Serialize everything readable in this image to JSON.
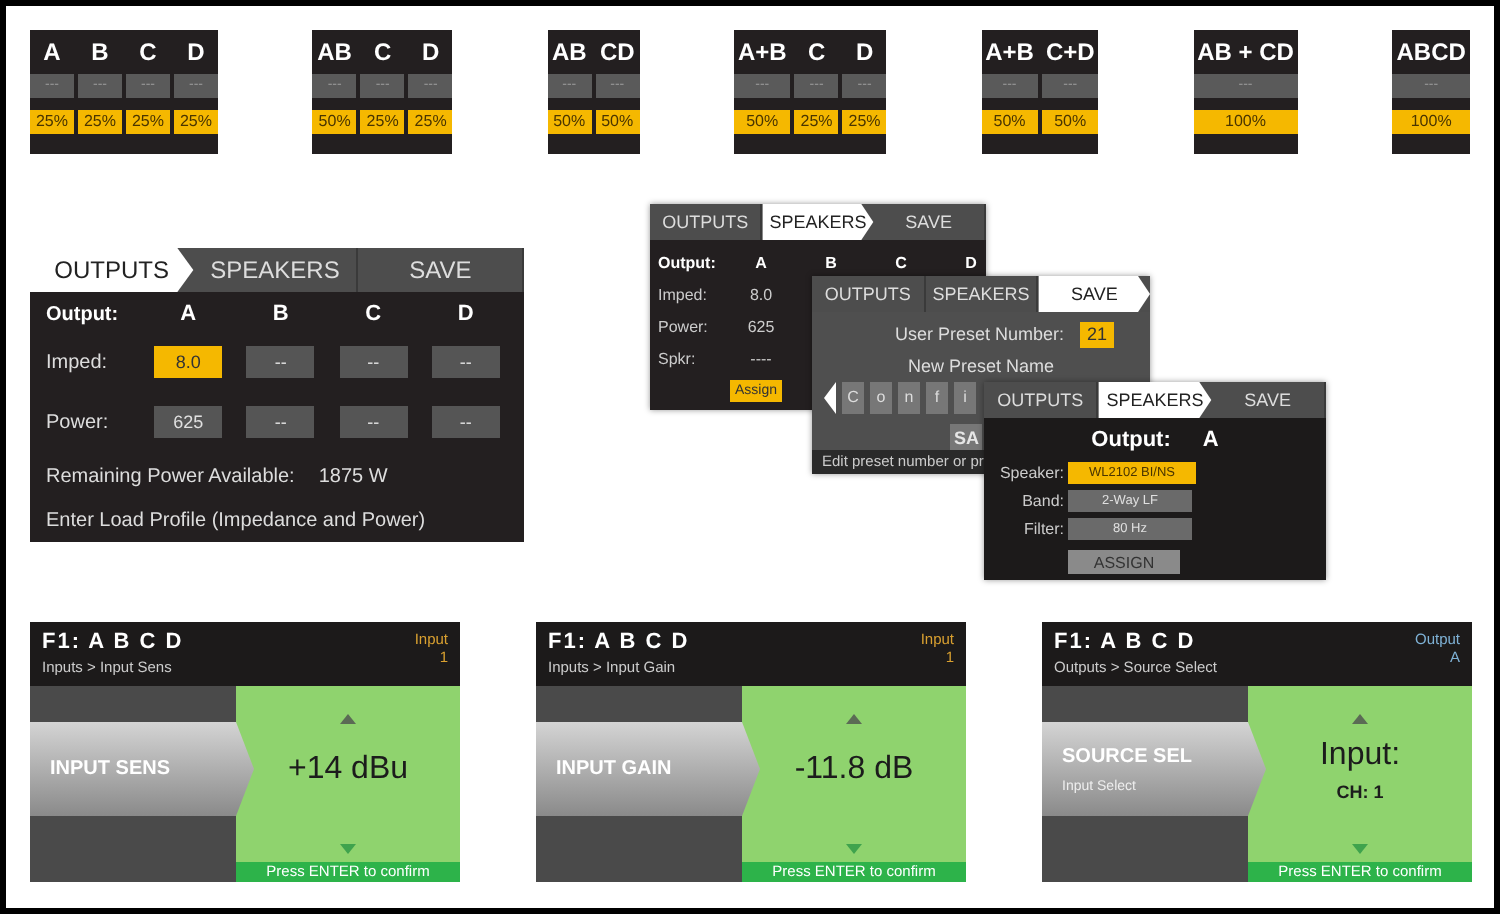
{
  "configurations": [
    {
      "columns": [
        {
          "label": "A",
          "value": "---",
          "share": "25%"
        },
        {
          "label": "B",
          "value": "---",
          "share": "25%"
        },
        {
          "label": "C",
          "value": "---",
          "share": "25%"
        },
        {
          "label": "D",
          "value": "---",
          "share": "25%"
        }
      ]
    },
    {
      "columns": [
        {
          "label": "AB",
          "value": "---",
          "share": "50%"
        },
        {
          "label": "C",
          "value": "---",
          "share": "25%"
        },
        {
          "label": "D",
          "value": "---",
          "share": "25%"
        }
      ]
    },
    {
      "columns": [
        {
          "label": "AB",
          "value": "---",
          "share": "50%"
        },
        {
          "label": "CD",
          "value": "---",
          "share": "50%"
        }
      ]
    },
    {
      "columns": [
        {
          "label": "A+B",
          "value": "---",
          "share": "50%"
        },
        {
          "label": "C",
          "value": "---",
          "share": "25%"
        },
        {
          "label": "D",
          "value": "---",
          "share": "25%"
        }
      ]
    },
    {
      "columns": [
        {
          "label": "A+B",
          "value": "---",
          "share": "50%"
        },
        {
          "label": "C+D",
          "value": "---",
          "share": "50%"
        }
      ]
    },
    {
      "columns": [
        {
          "label": "AB + CD",
          "value": "---",
          "share": "100%"
        }
      ]
    },
    {
      "columns": [
        {
          "label": "ABCD",
          "value": "---",
          "share": "100%"
        }
      ]
    }
  ],
  "load_screen": {
    "tabs": [
      {
        "label": "OUTPUTS",
        "selected": true
      },
      {
        "label": "SPEAKERS",
        "selected": false
      },
      {
        "label": "SAVE",
        "selected": false
      }
    ],
    "header": {
      "label": "Output:",
      "channels": [
        "A",
        "B",
        "C",
        "D"
      ]
    },
    "rows": [
      {
        "label": "Imped:",
        "cells": [
          {
            "value": "8.0",
            "selected": true
          },
          {
            "value": "--",
            "selected": false
          },
          {
            "value": "--",
            "selected": false
          },
          {
            "value": "--",
            "selected": false
          }
        ]
      },
      {
        "label": "Power:",
        "cells": [
          {
            "value": "625",
            "selected": false
          },
          {
            "value": "--",
            "selected": false
          },
          {
            "value": "--",
            "selected": false
          },
          {
            "value": "--",
            "selected": false
          }
        ]
      }
    ],
    "remaining": {
      "label": "Remaining Power Available:",
      "value": "1875 W"
    },
    "hint": "Enter Load Profile (Impedance and Power)"
  },
  "assign_screen": {
    "tabs": [
      {
        "label": "OUTPUTS",
        "selected": false
      },
      {
        "label": "SPEAKERS",
        "selected": true
      },
      {
        "label": "SAVE",
        "selected": false
      }
    ],
    "header": {
      "label": "Output:",
      "channels": [
        "A",
        "B",
        "C",
        "D"
      ]
    },
    "rows": [
      {
        "label": "Imped:",
        "value": "8.0"
      },
      {
        "label": "Power:",
        "value": "625"
      },
      {
        "label": "Spkr:",
        "value": "----"
      }
    ],
    "button": "Assign"
  },
  "save_screen": {
    "tabs": [
      {
        "label": "OUTPUTS",
        "selected": false
      },
      {
        "label": "SPEAKERS",
        "selected": false
      },
      {
        "label": "SAVE",
        "selected": true
      }
    ],
    "preset_number": {
      "label": "User Preset Number:",
      "value": "21"
    },
    "name_label": "New Preset Name",
    "characters": [
      "C",
      "o",
      "n",
      "f",
      "i"
    ],
    "save_button": "SA",
    "hint": "Edit preset number or pr"
  },
  "speaker_screen": {
    "tabs": [
      {
        "label": "OUTPUTS",
        "selected": false
      },
      {
        "label": "SPEAKERS",
        "selected": true
      },
      {
        "label": "SAVE",
        "selected": false
      }
    ],
    "output": {
      "label": "Output:",
      "value": "A"
    },
    "fields": [
      {
        "label": "Speaker:",
        "value": "WL2102 BI/NS",
        "selected": true
      },
      {
        "label": "Band:",
        "value": "2-Way LF",
        "selected": false
      },
      {
        "label": "Filter:",
        "value": "80 Hz",
        "selected": false
      }
    ],
    "button": "ASSIGN"
  },
  "device_screens": [
    {
      "title": "F1: A B C D",
      "breadcrumb": "Inputs > Input Sens",
      "channel": {
        "kind": "input",
        "label": "Input",
        "value": "1"
      },
      "menu_item": "INPUT SENS",
      "value": "+14 dBu",
      "confirm": "Press ENTER to confirm"
    },
    {
      "title": "F1: A B C D",
      "breadcrumb": "Inputs > Input Gain",
      "channel": {
        "kind": "input",
        "label": "Input",
        "value": "1"
      },
      "menu_item": "INPUT GAIN",
      "value": "-11.8 dB",
      "confirm": "Press ENTER to confirm"
    },
    {
      "title": "F1: A B C D",
      "breadcrumb": "Outputs > Source Select",
      "channel": {
        "kind": "output",
        "label": "Output",
        "value": "A"
      },
      "menu_item": "SOURCE SEL",
      "menu_sub": "Input Select",
      "value": "Input:",
      "value_sub": "CH: 1",
      "confirm": "Press ENTER to confirm"
    }
  ]
}
